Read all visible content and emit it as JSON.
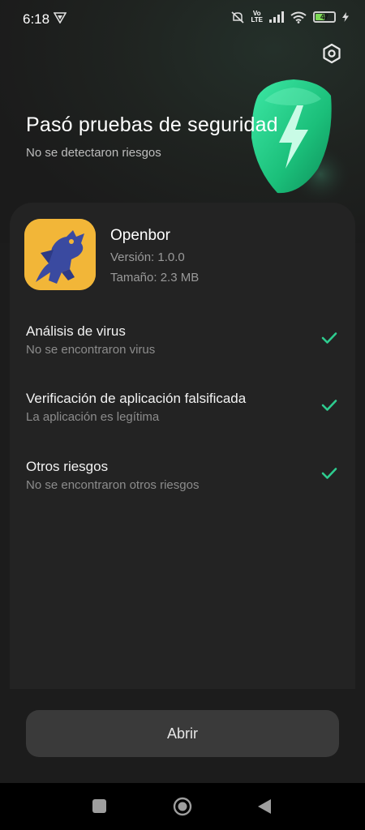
{
  "status_bar": {
    "time": "6:18",
    "volte_top": "Vo",
    "volte_bottom": "LTE",
    "battery_level": "47",
    "battery_fraction": 0.47,
    "icons": [
      "vpn-icon",
      "mute-icon",
      "volte-icon",
      "signal-icon",
      "wifi-icon",
      "battery-icon",
      "charging-bolt-icon"
    ]
  },
  "header": {
    "title": "Pasó pruebas de seguridad",
    "subtitle": "No se detectaron riesgos",
    "settings_icon": "gear-icon",
    "shield_icon": "shield-bolt-icon"
  },
  "app": {
    "name": "Openbor",
    "version": "Versión: 1.0.0",
    "size": "Tamaño: 2.3 MB"
  },
  "checks": [
    {
      "title": "Análisis de virus",
      "description": "No se encontraron virus",
      "status_icon": "checkmark-icon"
    },
    {
      "title": "Verificación de aplicación falsificada",
      "description": "La aplicación es legítima",
      "status_icon": "checkmark-icon"
    },
    {
      "title": "Otros riesgos",
      "description": "No se encontraron otros riesgos",
      "status_icon": "checkmark-icon"
    }
  ],
  "actions": {
    "open_label": "Abrir"
  },
  "nav": {
    "icons": [
      "recents-square-icon",
      "home-circle-icon",
      "back-triangle-icon"
    ]
  },
  "colors": {
    "background": "#1c1c1c",
    "card": "#232323",
    "accent_green": "#2ecc8f",
    "button": "#3a3a3a"
  }
}
